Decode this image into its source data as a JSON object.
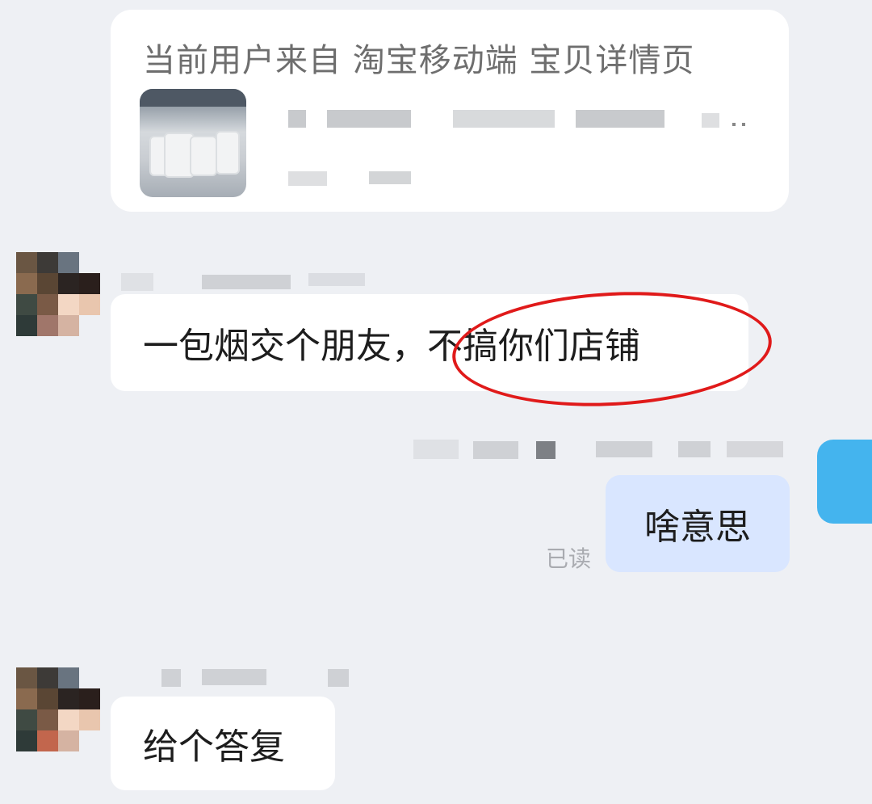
{
  "source_card": {
    "text": "当前用户来自 淘宝移动端 宝贝详情页",
    "product_image": "product-thumbnail-icon"
  },
  "messages": [
    {
      "sender": "customer",
      "text": "一包烟交个朋友，不搞你们店铺",
      "highlight": "不搞你们店铺",
      "highlight_color": "#e01a1a"
    },
    {
      "sender": "me",
      "text": "啥意思",
      "status": "已读"
    },
    {
      "sender": "customer",
      "text": "给个答复"
    }
  ],
  "colors": {
    "background": "#eef0f4",
    "bubble_left": "#ffffff",
    "bubble_right": "#d9e6ff",
    "annotation": "#e01a1a"
  }
}
